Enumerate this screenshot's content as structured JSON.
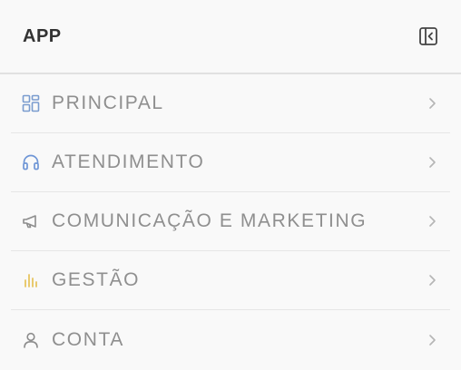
{
  "app": {
    "title": "APP",
    "collapse_icon": "sidebar-collapse-icon"
  },
  "menu": {
    "items": [
      {
        "label": "PRINCIPAL",
        "icon": "dashboard-grid-icon",
        "icon_color": "#7a9ccf"
      },
      {
        "label": "ATENDIMENTO",
        "icon": "headphones-icon",
        "icon_color": "#6f96d6"
      },
      {
        "label": "COMUNICAÇÃO E MARKETING",
        "icon": "megaphone-icon",
        "icon_color": "#8c8c8c"
      },
      {
        "label": "GESTÃO",
        "icon": "bar-chart-icon",
        "icon_color": "#e7c560"
      },
      {
        "label": "CONTA",
        "icon": "user-icon",
        "icon_color": "#8c8c8c"
      }
    ]
  },
  "colors": {
    "background": "#f9f9f9",
    "label": "#8f8f8f",
    "title": "#333333",
    "divider": "#e6e6e6"
  }
}
